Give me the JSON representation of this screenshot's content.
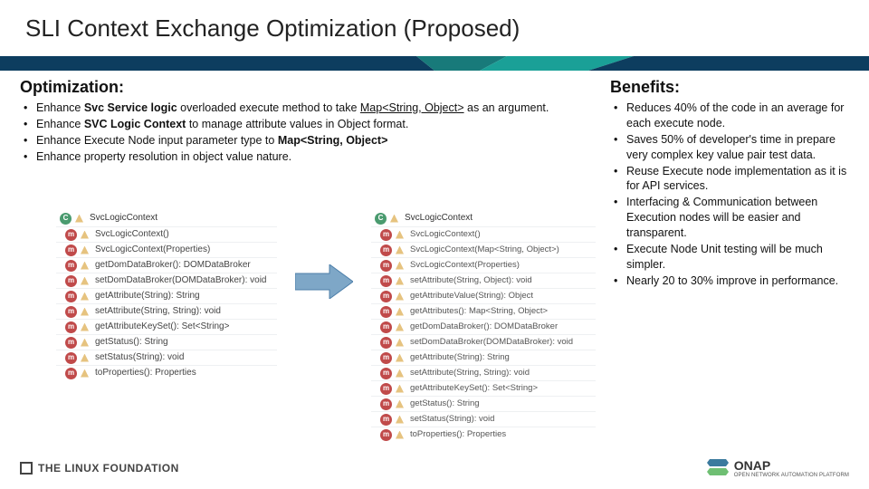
{
  "title": "SLI Context Exchange Optimization (Proposed)",
  "optimization": {
    "heading": "Optimization:",
    "items": [
      {
        "pre": "Enhance ",
        "bold": "Svc Service logic",
        "mid": " overloaded execute method to take ",
        "u": "Map<String, Object>",
        "post": " as an argument."
      },
      {
        "pre": "Enhance ",
        "bold": "SVC Logic Context",
        "post": " to manage attribute values in Object format."
      },
      {
        "pre": "Enhance Execute Node input parameter type to ",
        "bold": "Map<String, Object>"
      },
      {
        "pre": "Enhance property resolution in object value nature."
      }
    ]
  },
  "benefits": {
    "heading": "Benefits:",
    "items": [
      "Reduces 40% of the code in an average for each execute node.",
      "Saves 50% of developer's time in prepare very complex key value pair test data.",
      "Reuse Execute node implementation as it is for API services.",
      "Interfacing & Communication between Execution nodes will be easier and transparent.",
      "Execute Node Unit testing will be much simpler.",
      "Nearly 20 to 30% improve in performance."
    ]
  },
  "panel_left": {
    "class_name": "SvcLogicContext",
    "methods": [
      "SvcLogicContext()",
      "SvcLogicContext(Properties)",
      "getDomDataBroker(): DOMDataBroker",
      "setDomDataBroker(DOMDataBroker): void",
      "getAttribute(String): String",
      "setAttribute(String, String): void",
      "getAttributeKeySet(): Set<String>",
      "getStatus(): String",
      "setStatus(String): void",
      "toProperties(): Properties"
    ]
  },
  "panel_right": {
    "class_name": "SvcLogicContext",
    "methods": [
      "SvcLogicContext()",
      "SvcLogicContext(Map<String, Object>)",
      "SvcLogicContext(Properties)",
      "setAttribute(String, Object): void",
      "getAttributeValue(String): Object",
      "getAttributes(): Map<String, Object>",
      "getDomDataBroker(): DOMDataBroker",
      "setDomDataBroker(DOMDataBroker): void",
      "getAttribute(String): String",
      "setAttribute(String, String): void",
      "getAttributeKeySet(): Set<String>",
      "getStatus(): String",
      "setStatus(String): void",
      "toProperties(): Properties"
    ]
  },
  "footer": {
    "left": "THE LINUX FOUNDATION",
    "right": "ONAP",
    "right_sub": "OPEN NETWORK AUTOMATION PLATFORM"
  }
}
